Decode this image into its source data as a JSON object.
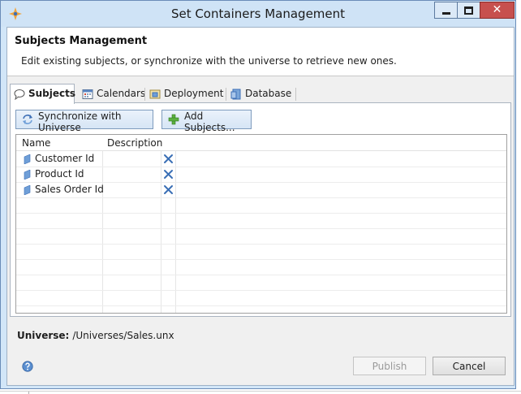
{
  "window": {
    "title": "Set Containers Management",
    "close_label": "✕"
  },
  "header": {
    "title": "Subjects Management",
    "description": "Edit existing subjects, or synchronize with the universe to retrieve new ones."
  },
  "tabs": [
    {
      "label": "Subjects",
      "icon": "speech-bubble-icon",
      "active": true
    },
    {
      "label": "Calendars",
      "icon": "calendar-icon",
      "active": false
    },
    {
      "label": "Deployment",
      "icon": "deployment-icon",
      "active": false
    },
    {
      "label": "Database",
      "icon": "database-icon",
      "active": false
    }
  ],
  "toolbar": {
    "sync_label": "Synchronize with Universe",
    "add_label": "Add Subjects..."
  },
  "table": {
    "columns": [
      "Name",
      "Description",
      ""
    ],
    "rows": [
      {
        "name": "Customer Id",
        "description": ""
      },
      {
        "name": "Product Id",
        "description": ""
      },
      {
        "name": "Sales Order Id",
        "description": ""
      }
    ]
  },
  "universe": {
    "label": "Universe:",
    "path": "/Universes/Sales.unx"
  },
  "footer": {
    "publish_label": "Publish",
    "cancel_label": "Cancel"
  },
  "colors": {
    "titlebar": "#cfe3f6",
    "close_button": "#c7504e",
    "delete_icon": "#3a6fb5",
    "subject_icon": "#6f9fd8"
  }
}
